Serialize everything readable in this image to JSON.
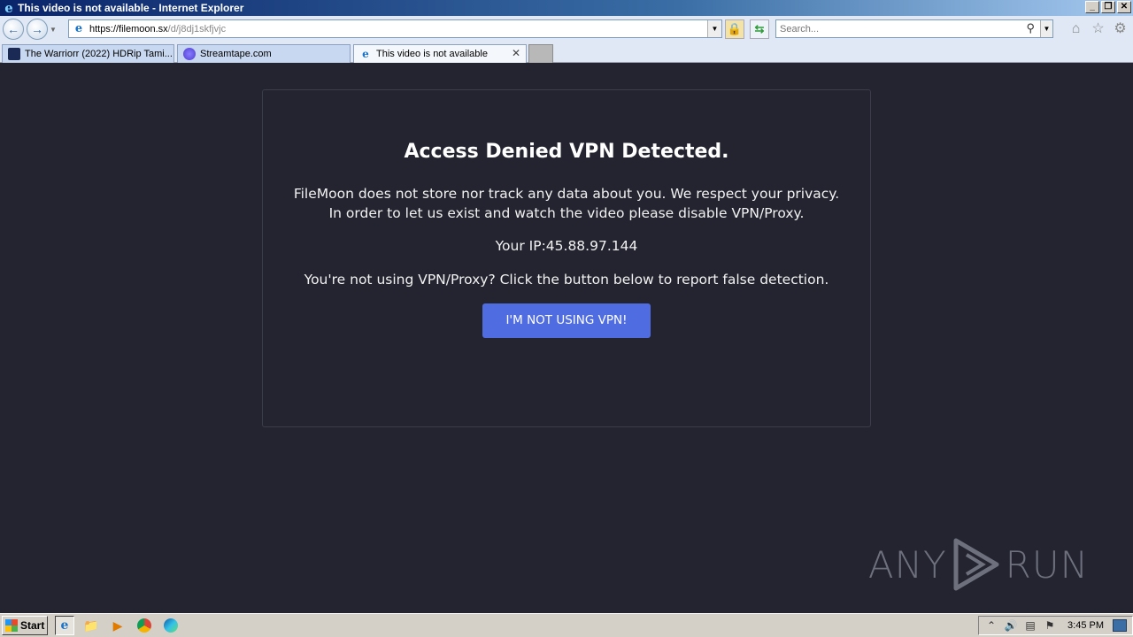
{
  "window": {
    "title": "This video is not available - Internet Explorer",
    "controls": {
      "minimize": "_",
      "restore": "❐",
      "close": "✕"
    }
  },
  "addressbar": {
    "url_host": "https://filemoon.sx",
    "url_path": "/d/j8dj1skfjvjc",
    "search_placeholder": "Search..."
  },
  "tabs": [
    {
      "label": "The Warriorr (2022) HDRip Tami..."
    },
    {
      "label": "Streamtape.com"
    },
    {
      "label": "This video is not available",
      "active": true
    }
  ],
  "page": {
    "heading": "Access Denied VPN Detected.",
    "message": "FileMoon does not store nor track any data about you. We respect your privacy. In order to let us exist and watch the video please disable VPN/Proxy.",
    "ip": "Your IP:45.88.97.144",
    "report_text": "You're not using VPN/Proxy? Click the button below to report false detection.",
    "button_label": "I'M NOT USING VPN!"
  },
  "watermark": {
    "left": "ANY",
    "right": "RUN"
  },
  "taskbar": {
    "start_label": "Start",
    "clock": "3:45 PM"
  },
  "colors": {
    "page_bg": "#23242f",
    "card_border": "#3b3d4b",
    "button_bg": "#4f6ce0",
    "text": "#ffffff"
  }
}
